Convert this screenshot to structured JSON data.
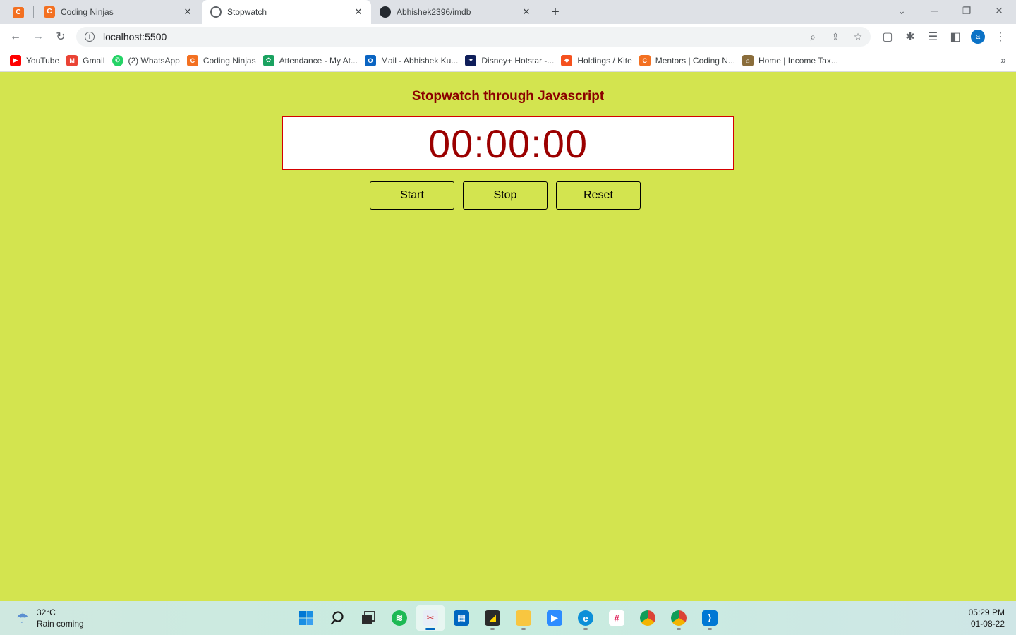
{
  "browser": {
    "tabs": [
      {
        "title": "Coding Ninjas",
        "icon": "coding-ninjas-icon"
      },
      {
        "title": "Stopwatch",
        "icon": "globe-icon",
        "active": true
      },
      {
        "title": "Abhishek2396/imdb",
        "icon": "github-icon"
      }
    ],
    "url": "localhost:5500",
    "profile_initial": "a",
    "bookmarks": [
      {
        "label": "YouTube",
        "icon": "youtube-icon",
        "color": "#ff0000"
      },
      {
        "label": "Gmail",
        "icon": "gmail-icon",
        "color": "#ea4335"
      },
      {
        "label": "(2) WhatsApp",
        "icon": "whatsapp-icon",
        "color": "#25d366"
      },
      {
        "label": "Coding Ninjas",
        "icon": "coding-ninjas-icon",
        "color": "#f37021"
      },
      {
        "label": "Attendance - My At...",
        "icon": "attendance-icon",
        "color": "#1aa260"
      },
      {
        "label": "Mail - Abhishek Ku...",
        "icon": "outlook-icon",
        "color": "#0a64c2"
      },
      {
        "label": "Disney+ Hotstar -...",
        "icon": "hotstar-icon",
        "color": "#0f1e5a"
      },
      {
        "label": "Holdings / Kite",
        "icon": "kite-icon",
        "color": "#f5511e"
      },
      {
        "label": "Mentors | Coding N...",
        "icon": "coding-ninjas-icon",
        "color": "#f37021"
      },
      {
        "label": "Home | Income Tax...",
        "icon": "income-tax-icon",
        "color": "#8a6d3b"
      }
    ]
  },
  "page": {
    "title": "Stopwatch through Javascript",
    "time": "00:00:00",
    "buttons": {
      "start": "Start",
      "stop": "Stop",
      "reset": "Reset"
    },
    "colors": {
      "background": "#d3e44f",
      "accent": "#8b0000",
      "display_border": "#d40000"
    }
  },
  "taskbar": {
    "weather": {
      "temp": "32°C",
      "desc": "Rain coming"
    },
    "apps": [
      {
        "name": "windows-start-icon"
      },
      {
        "name": "search-icon"
      },
      {
        "name": "task-view-icon"
      },
      {
        "name": "spotify-icon"
      },
      {
        "name": "snipping-tool-icon",
        "active": true
      },
      {
        "name": "microsoft-store-icon"
      },
      {
        "name": "sticky-notes-icon"
      },
      {
        "name": "file-explorer-icon"
      },
      {
        "name": "zoom-icon"
      },
      {
        "name": "edge-icon"
      },
      {
        "name": "slack-icon"
      },
      {
        "name": "chrome-icon"
      },
      {
        "name": "chrome-profile-icon"
      },
      {
        "name": "vscode-icon"
      }
    ],
    "clock": {
      "time": "05:29 PM",
      "date": "01-08-22"
    }
  }
}
